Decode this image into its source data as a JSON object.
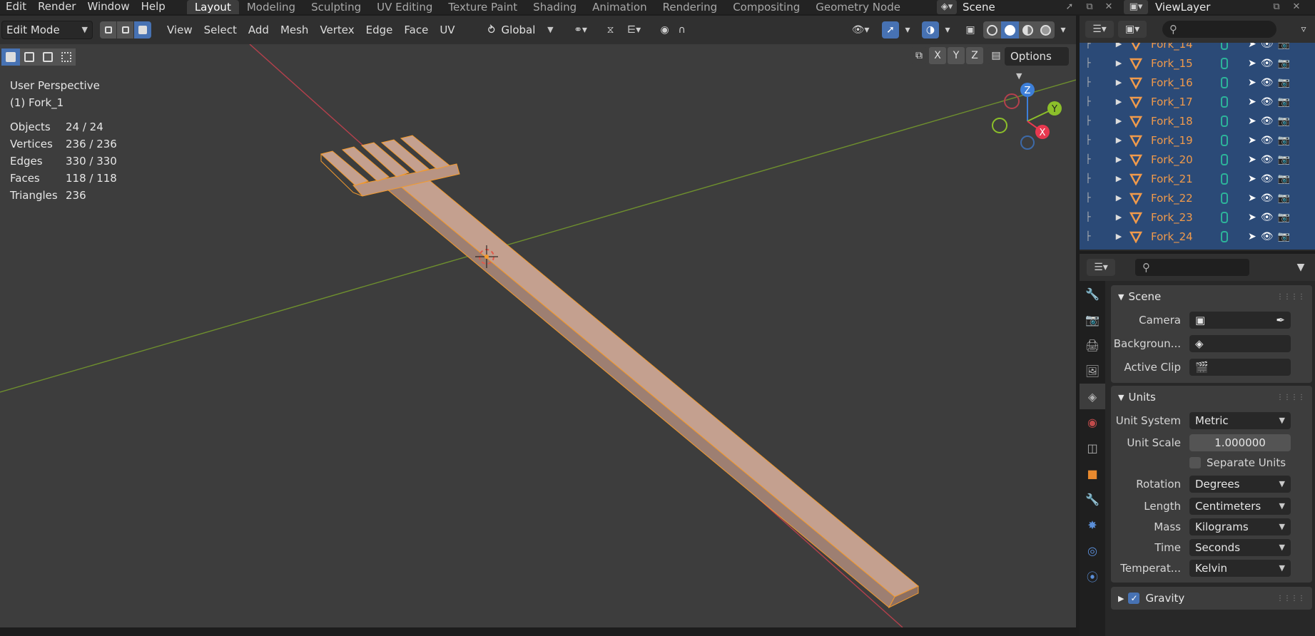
{
  "topbar": {
    "menus": [
      "Edit",
      "Render",
      "Window",
      "Help"
    ],
    "workspaces": [
      "Layout",
      "Modeling",
      "Sculpting",
      "UV Editing",
      "Texture Paint",
      "Shading",
      "Animation",
      "Rendering",
      "Compositing",
      "Geometry Node"
    ],
    "active_workspace": "Layout",
    "scene_name": "Scene",
    "view_layer_name": "ViewLayer"
  },
  "viewport": {
    "mode": "Edit Mode",
    "menus": [
      "View",
      "Select",
      "Add",
      "Mesh",
      "Vertex",
      "Edge",
      "Face",
      "UV"
    ],
    "transform_orientation": "Global",
    "options_label": "Options",
    "axis_buttons": [
      "X",
      "Y",
      "Z"
    ],
    "view_name": "User Perspective",
    "active_object": "(1) Fork_1",
    "stats": [
      {
        "label": "Objects",
        "value": "24 / 24"
      },
      {
        "label": "Vertices",
        "value": "236 / 236"
      },
      {
        "label": "Edges",
        "value": "330 / 330"
      },
      {
        "label": "Faces",
        "value": "118 / 118"
      },
      {
        "label": "Triangles",
        "value": "236"
      }
    ],
    "gizmo_labels": [
      "Z",
      "Y",
      "X"
    ],
    "colors": {
      "background": "#3d3d3d",
      "x_axis": "#b5404c",
      "y_axis": "#6e8f2e",
      "mesh": "#c4a08f",
      "selection": "#f49a2c"
    }
  },
  "outliner": {
    "items": [
      "Fork_14",
      "Fork_15",
      "Fork_16",
      "Fork_17",
      "Fork_18",
      "Fork_19",
      "Fork_20",
      "Fork_21",
      "Fork_22",
      "Fork_23",
      "Fork_24"
    ]
  },
  "properties": {
    "scene_panel": {
      "title": "Scene",
      "camera_label": "Camera",
      "background_label": "Backgroun...",
      "active_clip_label": "Active Clip"
    },
    "units_panel": {
      "title": "Units",
      "unit_system_label": "Unit System",
      "unit_system": "Metric",
      "unit_scale_label": "Unit Scale",
      "unit_scale": "1.000000",
      "separate_units_label": "Separate Units",
      "rotation_label": "Rotation",
      "rotation": "Degrees",
      "length_label": "Length",
      "length": "Centimeters",
      "mass_label": "Mass",
      "mass": "Kilograms",
      "time_label": "Time",
      "time": "Seconds",
      "temperature_label": "Temperat...",
      "temperature": "Kelvin"
    },
    "gravity_panel": {
      "title": "Gravity"
    }
  }
}
